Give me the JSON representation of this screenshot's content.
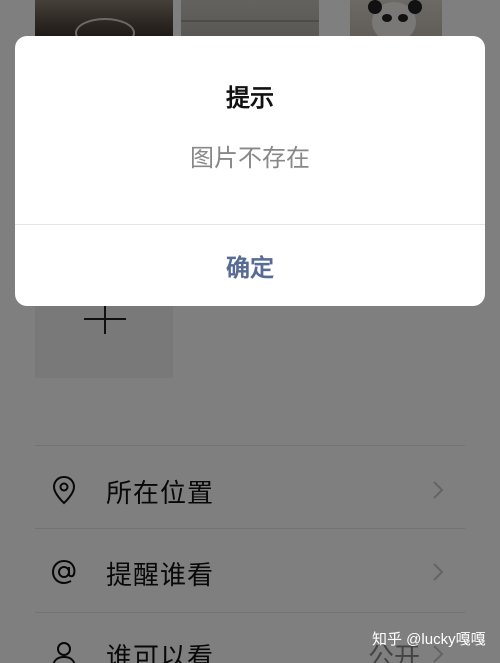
{
  "dialog": {
    "title": "提示",
    "message": "图片不存在",
    "confirm_label": "确定"
  },
  "options": [
    {
      "label": "所在位置",
      "icon": "location-pin-icon",
      "value": ""
    },
    {
      "label": "提醒谁看",
      "icon": "at-sign-icon",
      "value": ""
    },
    {
      "label": "谁可以看",
      "icon": "person-icon",
      "value": "公开"
    }
  ],
  "watermark": "知乎 @lucky嘎嘎",
  "colors": {
    "dialog_button": "#576b95",
    "overlay": "rgba(0,0,0,0.5)"
  }
}
